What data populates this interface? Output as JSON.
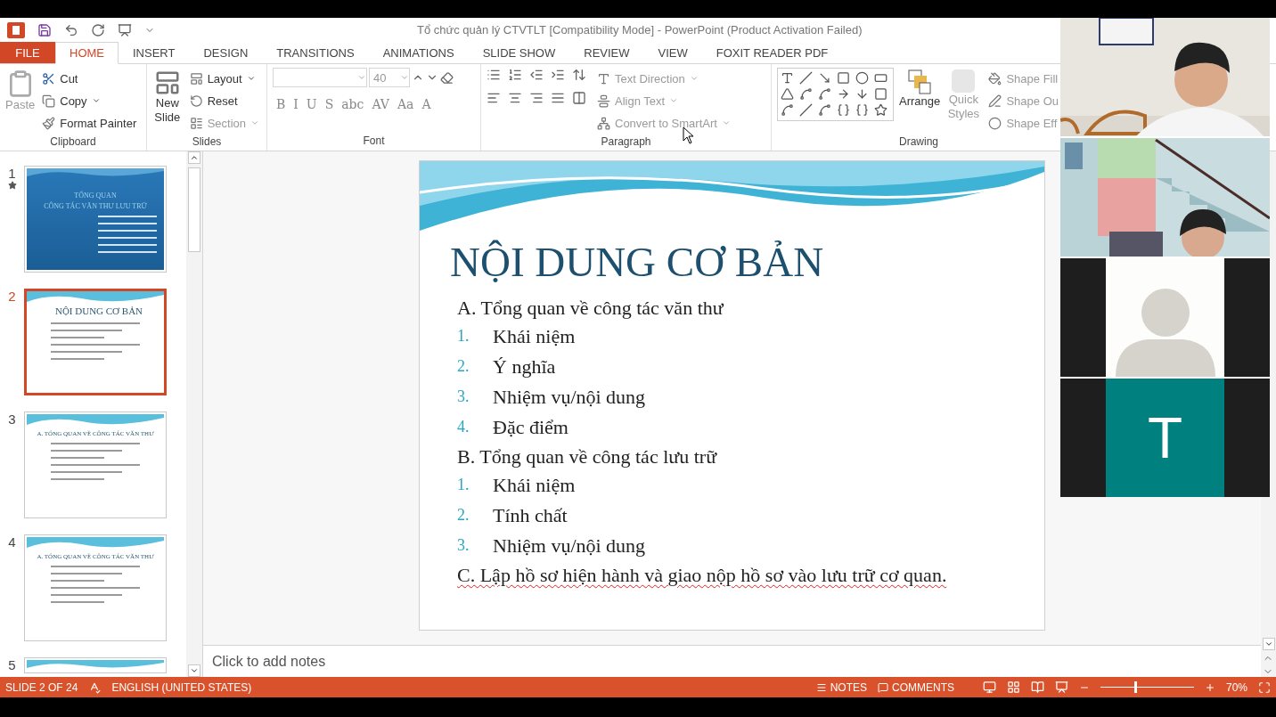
{
  "window": {
    "title": "Tổ chức quản lý CTVTLT [Compatibility Mode] - PowerPoint (Product Activation Failed)"
  },
  "tabs": [
    {
      "label": "FILE",
      "kind": "file",
      "selected": false
    },
    {
      "label": "HOME",
      "kind": "tab",
      "selected": true
    },
    {
      "label": "INSERT",
      "kind": "tab",
      "selected": false
    },
    {
      "label": "DESIGN",
      "kind": "tab",
      "selected": false
    },
    {
      "label": "TRANSITIONS",
      "kind": "tab",
      "selected": false
    },
    {
      "label": "ANIMATIONS",
      "kind": "tab",
      "selected": false
    },
    {
      "label": "SLIDE SHOW",
      "kind": "tab",
      "selected": false
    },
    {
      "label": "REVIEW",
      "kind": "tab",
      "selected": false
    },
    {
      "label": "VIEW",
      "kind": "tab",
      "selected": false
    },
    {
      "label": "FOXIT READER PDF",
      "kind": "tab",
      "selected": false
    }
  ],
  "ribbon": {
    "clipboard": {
      "label": "Clipboard",
      "paste": {
        "label": "Paste",
        "disabled": true
      },
      "commands": [
        {
          "label": "Cut",
          "disabled": false
        },
        {
          "label": "Copy",
          "disabled": false
        },
        {
          "label": "Format Painter",
          "disabled": false
        }
      ]
    },
    "slides": {
      "label": "Slides",
      "new_slide": {
        "label": "New Slide",
        "disabled": false
      },
      "commands": [
        {
          "label": "Layout",
          "disabled": false
        },
        {
          "label": "Reset",
          "disabled": false
        },
        {
          "label": "Section",
          "disabled": true
        }
      ]
    },
    "font": {
      "label": "Font",
      "size": "40",
      "buttons": [
        "B",
        "I",
        "U",
        "S",
        "abc",
        "AV",
        "Aa",
        "A"
      ]
    },
    "paragraph": {
      "label": "Paragraph",
      "commands": [
        {
          "label": "Text Direction",
          "disabled": true
        },
        {
          "label": "Align Text",
          "disabled": true
        },
        {
          "label": "Convert to SmartArt",
          "disabled": true
        }
      ]
    },
    "drawing": {
      "label": "Drawing",
      "arrange": {
        "label": "Arrange",
        "disabled": false
      },
      "quick_styles": {
        "label": "Quick Styles",
        "disabled": true
      },
      "commands": [
        {
          "label": "Shape Fill",
          "disabled": true
        },
        {
          "label": "Shape Ou",
          "disabled": true
        },
        {
          "label": "Shape Eff",
          "disabled": true
        }
      ]
    }
  },
  "thumbnails": [
    {
      "number": "1",
      "animated": true,
      "selected": false,
      "kind": "title",
      "title_lines": [
        "TỔNG QUAN",
        "CÔNG TÁC VĂN THƯ LƯU TRỮ"
      ]
    },
    {
      "number": "2",
      "animated": false,
      "selected": true,
      "kind": "content",
      "title_lines": [
        "NỘI DUNG CƠ BẢN"
      ]
    },
    {
      "number": "3",
      "animated": false,
      "selected": false,
      "kind": "section",
      "title_lines": [
        "A. TỔNG QUAN VỀ CÔNG TÁC VĂN THƯ"
      ]
    },
    {
      "number": "4",
      "animated": false,
      "selected": false,
      "kind": "section",
      "title_lines": [
        "A. TỔNG QUAN VỀ CÔNG TÁC VĂN THƯ"
      ]
    },
    {
      "number": "5",
      "animated": false,
      "selected": false,
      "kind": "partial"
    }
  ],
  "slide": {
    "title": "NỘI DUNG CƠ BẢN",
    "items": [
      {
        "kind": "heading",
        "text": "A. Tổng quan về công tác văn thư",
        "misspelled": false
      },
      {
        "kind": "numbered",
        "number": "1.",
        "text": "Khái niệm",
        "misspelled": false
      },
      {
        "kind": "numbered",
        "number": "2.",
        "text": "Ý nghĩa",
        "misspelled": false
      },
      {
        "kind": "numbered",
        "number": "3.",
        "text": "Nhiệm vụ/nội dung",
        "misspelled": false
      },
      {
        "kind": "numbered",
        "number": "4.",
        "text": "Đặc điểm",
        "misspelled": false
      },
      {
        "kind": "heading",
        "text": "B. Tổng quan về công tác lưu trữ",
        "misspelled": false
      },
      {
        "kind": "numbered",
        "number": "1.",
        "text": "Khái niệm",
        "misspelled": false
      },
      {
        "kind": "numbered",
        "number": "2.",
        "text": "Tính chất",
        "misspelled": false
      },
      {
        "kind": "numbered",
        "number": "3.",
        "text": "Nhiệm vụ/nội dung",
        "misspelled": false
      },
      {
        "kind": "heading",
        "text": "C. Lập hồ sơ hiện hành và giao nộp hồ sơ vào lưu trữ cơ quan.",
        "misspelled": true
      }
    ]
  },
  "notes": {
    "placeholder": "Click to add notes"
  },
  "status_bar": {
    "slide": "SLIDE 2 OF 24",
    "language": "ENGLISH (UNITED STATES)",
    "notes": "NOTES",
    "comments": "COMMENTS",
    "zoom": "70%",
    "zoom_slider": {
      "level": 0.36
    }
  },
  "video_call": {
    "tiles": [
      {
        "kind": "video"
      },
      {
        "kind": "video"
      },
      {
        "kind": "avatar"
      },
      {
        "kind": "initial",
        "letter": "T",
        "color": "#00807f"
      }
    ]
  }
}
